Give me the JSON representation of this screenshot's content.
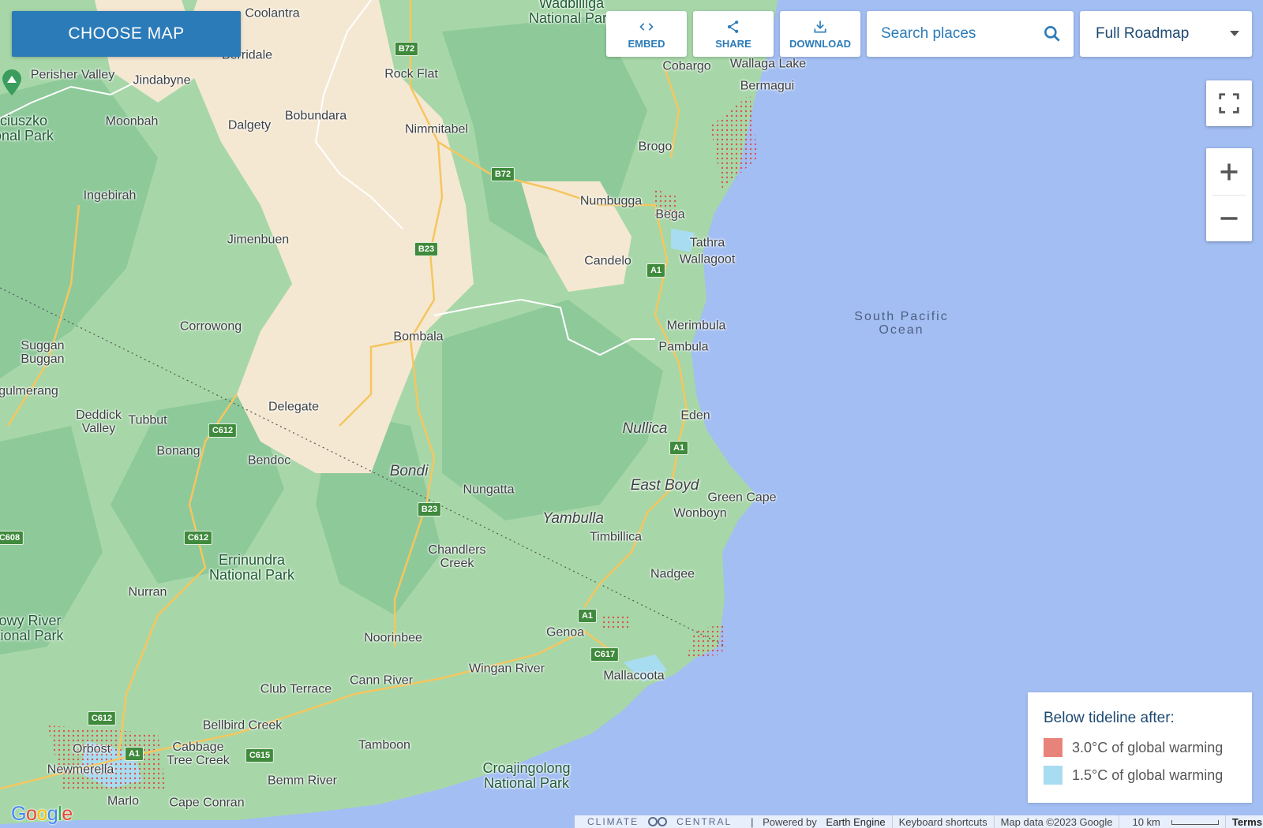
{
  "toolbar": {
    "choose_map_label": "CHOOSE MAP",
    "embed_label": "EMBED",
    "share_label": "SHARE",
    "download_label": "DOWNLOAD",
    "search_placeholder": "Search places",
    "map_style_selected": "Full Roadmap"
  },
  "icons": {
    "embed": "code-brackets-icon",
    "share": "share-icon",
    "download": "download-icon",
    "search": "search-icon",
    "fullscreen": "fullscreen-icon",
    "zoom_in": "plus-icon",
    "zoom_out": "minus-icon",
    "poi": "park-pin-icon"
  },
  "legend": {
    "title": "Below tideline after:",
    "items": [
      {
        "label": "3.0°C of global warming",
        "color": "#e8837b"
      },
      {
        "label": "1.5°C of global warming",
        "color": "#a8dcf0"
      }
    ]
  },
  "attribution": {
    "brand": "CLIMATE",
    "brand2": "CENTRAL",
    "powered_prefix": "Powered by",
    "powered_name": "Earth Engine",
    "keyboard": "Keyboard shortcuts",
    "map_data": "Map data ©2023 Google",
    "scale": "10 km",
    "terms": "Terms",
    "google": "Google"
  },
  "colors": {
    "ocean": "#a3bef3",
    "forest": "#a7d7a8",
    "dense_forest": "#8ec99a",
    "land": "#f5e8d2",
    "accent": "#2b7bb9",
    "road": "#f5c65f"
  },
  "places": [
    {
      "name": "Wadbilliga\nNational Park",
      "cls": "park"
    },
    {
      "name": "Jindabyne"
    },
    {
      "name": "Berridale"
    },
    {
      "name": "Perisher Valley"
    },
    {
      "name": "Rock Flat"
    },
    {
      "name": "Cobargo"
    },
    {
      "name": "Wallaga Lake"
    },
    {
      "name": "Bermagui"
    },
    {
      "name": "Moonbah"
    },
    {
      "name": "Dalgety"
    },
    {
      "name": "Bobundara"
    },
    {
      "name": "Nimmitabel"
    },
    {
      "name": "Brogo"
    },
    {
      "name": "Ingebirah"
    },
    {
      "name": "Numbugga"
    },
    {
      "name": "Bega"
    },
    {
      "name": "Tathra"
    },
    {
      "name": "Jimenbuen"
    },
    {
      "name": "Candelo"
    },
    {
      "name": "Wallagoot"
    },
    {
      "name": "South Pacific\nOcean",
      "cls": "ocean"
    },
    {
      "name": "Corrowong"
    },
    {
      "name": "Merimbula"
    },
    {
      "name": "Bombala"
    },
    {
      "name": "Pambula"
    },
    {
      "name": "Suggan\nBuggan"
    },
    {
      "name": "Delegate"
    },
    {
      "name": "Eden"
    },
    {
      "name": "Nullica",
      "cls": "italic"
    },
    {
      "name": "Deddick\nValley"
    },
    {
      "name": "Tubbut"
    },
    {
      "name": "Bonang"
    },
    {
      "name": "Bendoc"
    },
    {
      "name": "Bondi",
      "cls": "italic"
    },
    {
      "name": "Nungatta"
    },
    {
      "name": "East Boyd",
      "cls": "italic"
    },
    {
      "name": "Green Cape"
    },
    {
      "name": "Wonboyn"
    },
    {
      "name": "Yambulla",
      "cls": "italic"
    },
    {
      "name": "Timbillica"
    },
    {
      "name": "Errinundra\nNational Park",
      "cls": "park"
    },
    {
      "name": "Chandlers\nCreek"
    },
    {
      "name": "Nadgee"
    },
    {
      "name": "Nurran"
    },
    {
      "name": "Genoa"
    },
    {
      "name": "Noorinbee"
    },
    {
      "name": "Wingan River"
    },
    {
      "name": "Cann River"
    },
    {
      "name": "Club Terrace"
    },
    {
      "name": "Mallacoota"
    },
    {
      "name": "Bellbird Creek"
    },
    {
      "name": "Orbost"
    },
    {
      "name": "Cabbage\nTree Creek"
    },
    {
      "name": "Tamboon"
    },
    {
      "name": "Croajingolong\nNational Park",
      "cls": "park"
    },
    {
      "name": "Newmerella"
    },
    {
      "name": "Bemm River"
    },
    {
      "name": "Marlo"
    },
    {
      "name": "Cape Conran"
    },
    {
      "name": "ciuszko\nonal Park",
      "cls": "park"
    },
    {
      "name": "owy River\ntional Park",
      "cls": "park"
    },
    {
      "name": "gulmerang"
    },
    {
      "name": "Coolantra"
    }
  ],
  "shields": [
    "B72",
    "B72",
    "B23",
    "A1",
    "C612",
    "A1",
    "B23",
    "C612",
    "A1",
    "C617",
    "C612",
    "A1",
    "C615",
    "C608"
  ]
}
